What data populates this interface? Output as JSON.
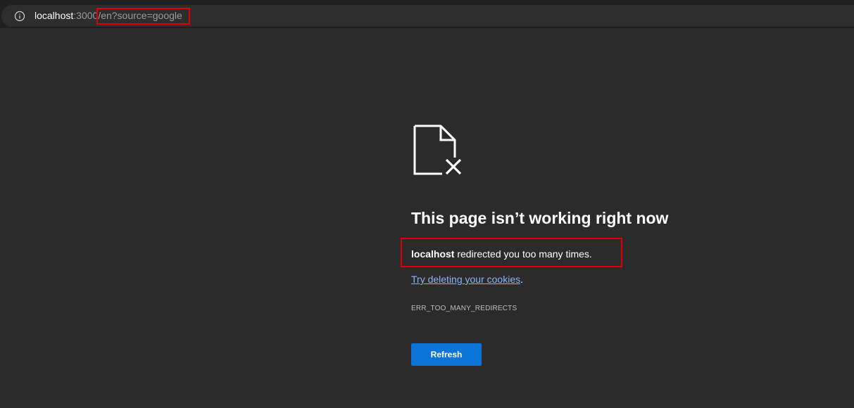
{
  "address_bar": {
    "host": "localhost",
    "port": ":3000",
    "path": "/en?source=google",
    "info_icon": "info-icon"
  },
  "error_page": {
    "icon": "document-error-icon",
    "headline": "This page isn’t working right now",
    "message_host": "localhost",
    "message_rest": " redirected you too many times.",
    "suggestion_link": "Try deleting your cookies",
    "suggestion_suffix": ".",
    "error_code": "ERR_TOO_MANY_REDIRECTS",
    "refresh_label": "Refresh"
  },
  "colors": {
    "background": "#2b2b2b",
    "link": "#8ab4f8",
    "button": "#0a74d9",
    "annotation_highlight": "#e00000"
  }
}
